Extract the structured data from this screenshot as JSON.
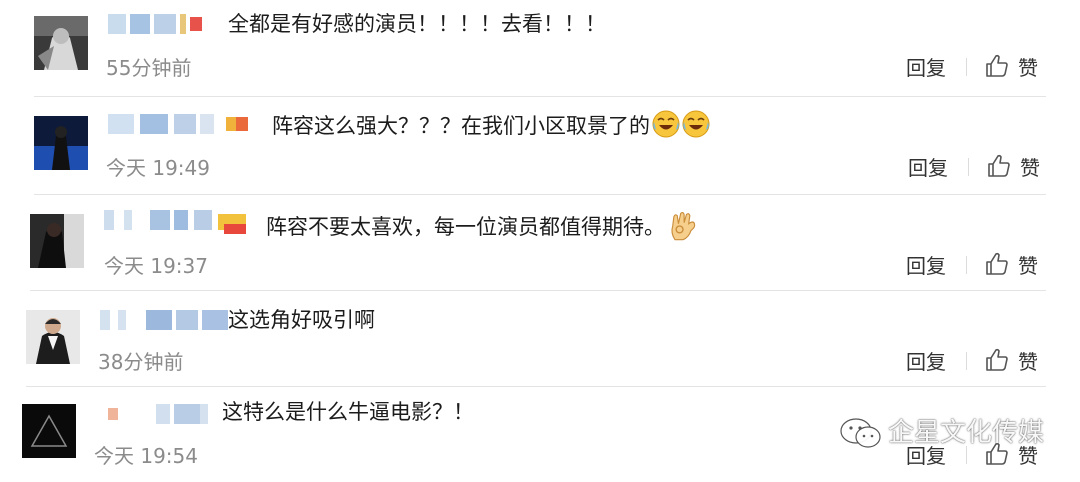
{
  "comments": [
    {
      "text": "全都是有好感的演员！！！！去看！！！",
      "time": "55分钟前",
      "reply_label": "回复",
      "like_label": "赞"
    },
    {
      "text": "阵容这么强大？？？在我们小区取景了的",
      "time": "今天 19:49",
      "reply_label": "回复",
      "like_label": "赞",
      "emojis": [
        "laughing-crying-emoji",
        "laughing-crying-emoji"
      ]
    },
    {
      "text": "阵容不要太喜欢，每一位演员都值得期待。",
      "time": "今天 19:37",
      "reply_label": "回复",
      "like_label": "赞",
      "emojis": [
        "ok-hand-emoji"
      ]
    },
    {
      "text": "这选角好吸引啊",
      "time": "38分钟前",
      "reply_label": "回复",
      "like_label": "赞"
    },
    {
      "text": "这特么是什么牛逼电影？！",
      "time": "今天 19:54",
      "reply_label": "回复",
      "like_label": "赞"
    }
  ],
  "watermark": {
    "text": "企星文化传媒",
    "icon": "wechat-icon"
  },
  "colors": {
    "text": "#1c1c1c",
    "muted": "#8b8b8b",
    "divider": "#e4e4e4",
    "background": "#ffffff"
  }
}
